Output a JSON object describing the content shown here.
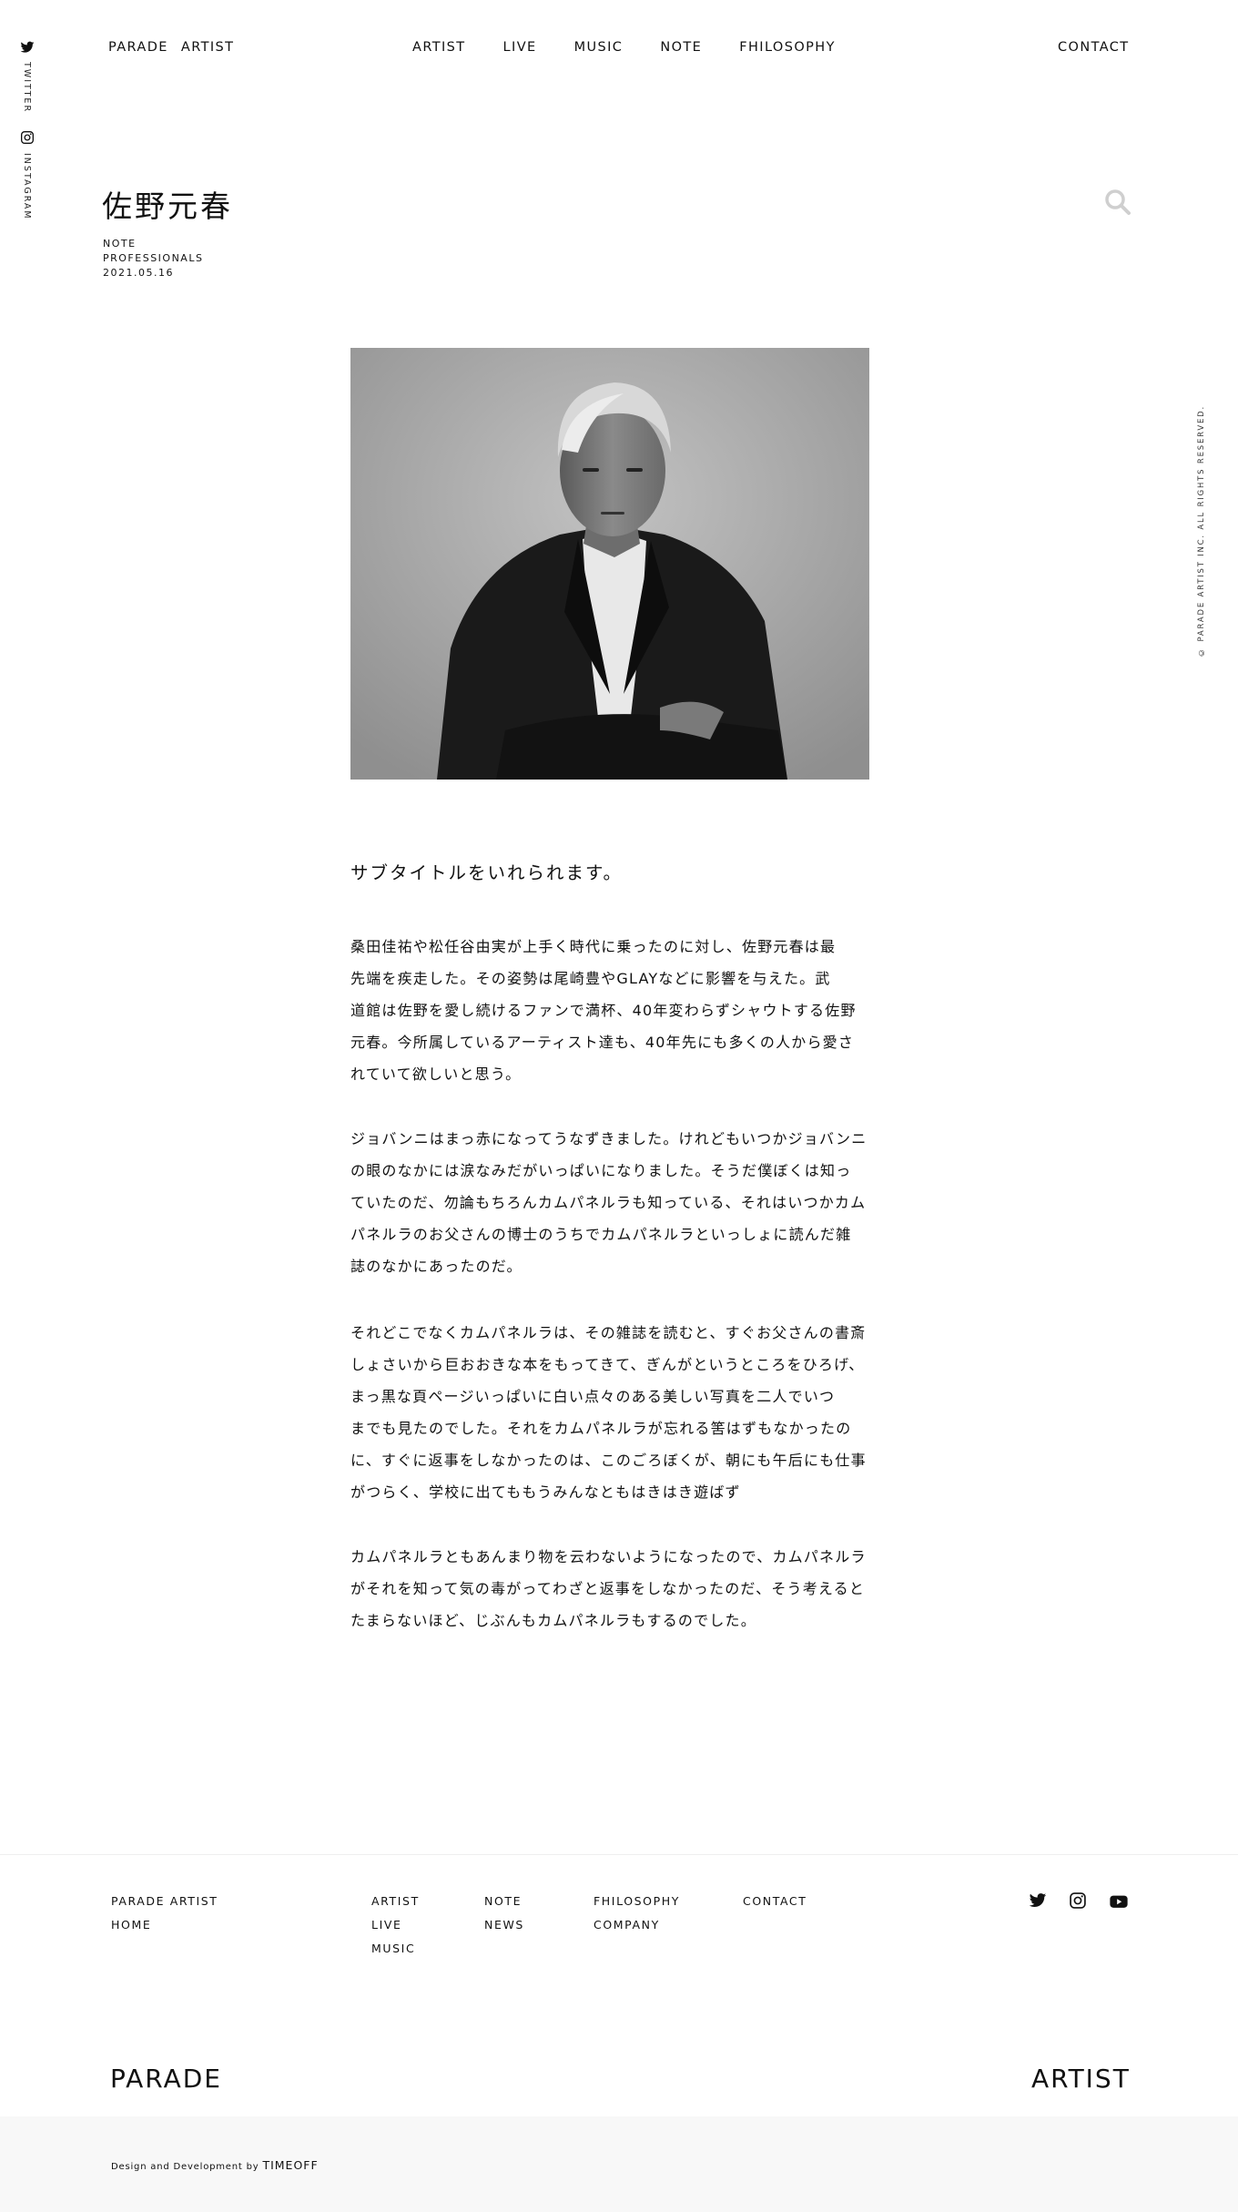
{
  "rail": {
    "twitter_label": "TWITTER",
    "instagram_label": "INSTAGRAM"
  },
  "header": {
    "brand": "PARADE ARTIST",
    "nav": [
      "ARTIST",
      "LIVE",
      "MUSIC",
      "NOTE",
      "FHILOSOPHY"
    ],
    "contact": "CONTACT"
  },
  "article": {
    "title": "佐野元春",
    "category": "NOTE",
    "tag": "PROFESSIONALS",
    "date": "2021.05.16",
    "subtitle": "サブタイトルをいれられます。",
    "paragraphs": [
      [
        "桑田佳祐や松任谷由実が上手く時代に乗ったのに対し、佐野元春は最",
        "先端を疾走した。その姿勢は尾崎豊やGLAYなどに影響を与えた。武",
        "道館は佐野を愛し続けるファンで満杯、40年変わらずシャウトする佐野",
        "元春。今所属しているアーティスト達も、40年先にも多くの人から愛さ",
        "れていて欲しいと思う。"
      ],
      [
        "ジョバンニはまっ赤になってうなずきました。けれどもいつかジョバンニ",
        "の眼のなかには涙なみだがいっぱいになりました。そうだ僕ぼくは知っ",
        "ていたのだ、勿論もちろんカムパネルラも知っている、それはいつかカム",
        "パネルラのお父さんの博士のうちでカムパネルラといっしょに読んだ雑",
        "誌のなかにあったのだ。"
      ],
      [
        "それどこでなくカムパネルラは、その雑誌を読むと、すぐお父さんの書斎",
        "しょさいから巨おおきな本をもってきて、ぎんがというところをひろげ、",
        "まっ黒な頁ページいっぱいに白い点々のある美しい写真を二人でいつ",
        "までも見たのでした。それをカムパネルラが忘れる筈はずもなかったの",
        "に、すぐに返事をしなかったのは、このごろぼくが、朝にも午后にも仕事",
        "がつらく、学校に出てももうみんなともはきはき遊ばず"
      ],
      [
        "カムパネルラともあんまり物を云わないようになったので、カムパネルラ",
        "がそれを知って気の毒がってわざと返事をしなかったのだ、そう考えると",
        "たまらないほど、じぶんもカムパネルラもするのでした。"
      ]
    ]
  },
  "copyright": "© PARADE ARTIST INC. ALL RIGHTS RESERVED.",
  "footer": {
    "col1": [
      "PARADE ARTIST",
      "HOME"
    ],
    "col2": [
      "ARTIST",
      "LIVE",
      "MUSIC"
    ],
    "col3": [
      "NOTE",
      "NEWS"
    ],
    "col4": [
      "FHILOSOPHY",
      "COMPANY"
    ],
    "col5": [
      "CONTACT"
    ],
    "social_icons": [
      "twitter-icon",
      "instagram-icon",
      "youtube-icon"
    ],
    "logo_left": "PARADE",
    "logo_right": "ARTIST",
    "credit_prefix": "Design and Development by",
    "credit_name": "TIMEOFF"
  }
}
